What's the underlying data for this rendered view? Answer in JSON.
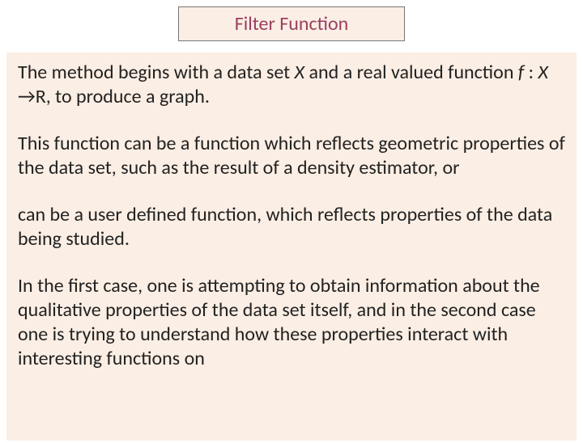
{
  "title": "Filter Function",
  "paragraphs": {
    "p1_a": "The method begins with a data set ",
    "p1_X": "X",
    "p1_b": " and a real valued function ",
    "p1_f": "f",
    "p1_c": " : ",
    "p1_X2": "X",
    "p1_d": " →R, to produce a graph.",
    "p2": "This function can be a function which reflects geometric properties of the data set, such as the result of a density estimator, or",
    "p3": "can be a user defined function, which reflects properties of the data being studied.",
    "p4": "In the first case, one is attempting to obtain information about the qualitative properties of the data set itself, and in the second case one is trying to understand how these properties interact with interesting functions on"
  }
}
